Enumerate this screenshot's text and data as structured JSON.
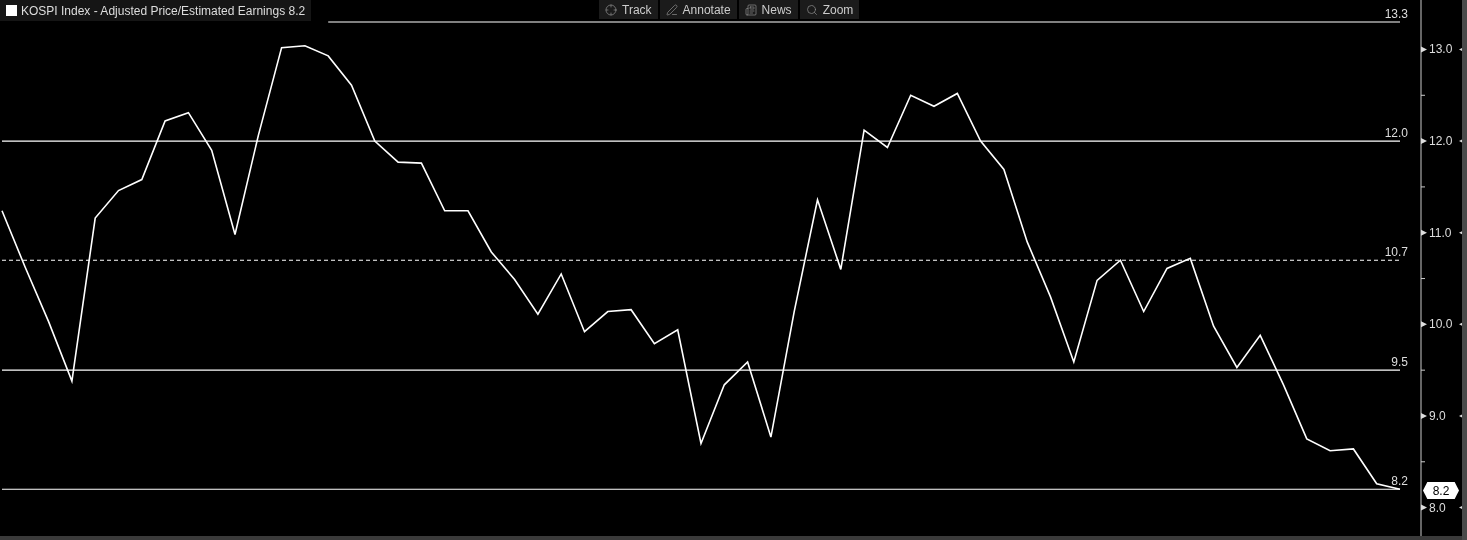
{
  "legend": {
    "label": "KOSPI Index - Adjusted Price/Estimated Earnings 8.2"
  },
  "toolbar": [
    {
      "label": "Track",
      "kind": "track"
    },
    {
      "label": "Annotate",
      "kind": "annotate"
    },
    {
      "label": "News",
      "kind": "news"
    },
    {
      "label": "Zoom",
      "kind": "zoom"
    }
  ],
  "chart": {
    "last_value": "8.2",
    "chart_data": {
      "type": "line",
      "ylim": [
        7.69,
        13.54
      ],
      "yticks": [
        {
          "value": 8,
          "label": "8.0"
        },
        {
          "value": 9,
          "label": "9.0"
        },
        {
          "value": 10,
          "label": "10.0"
        },
        {
          "value": 11,
          "label": "11.0"
        },
        {
          "value": 12,
          "label": "12.0"
        },
        {
          "value": 13,
          "label": "13.0"
        }
      ],
      "series": [
        {
          "color": "#ffffff",
          "line_style": "solid",
          "values": [
            11.24,
            10.62,
            10.03,
            9.38,
            11.16,
            11.46,
            11.58,
            12.22,
            12.31,
            11.9,
            10.98,
            12.06,
            13.02,
            13.04,
            12.93,
            12.61,
            12.0,
            11.77,
            11.76,
            11.24,
            11.24,
            10.79,
            10.49,
            10.11,
            10.55,
            9.92,
            10.14,
            10.16,
            9.79,
            9.94,
            8.7,
            9.34,
            9.59,
            8.77,
            10.14,
            11.36,
            10.6,
            12.12,
            11.93,
            12.5,
            12.38,
            12.52,
            12.0,
            11.69,
            10.9,
            10.3,
            9.59,
            10.48,
            10.7,
            10.14,
            10.61,
            10.72,
            9.98,
            9.53,
            9.88,
            9.34,
            8.75,
            8.62,
            8.64,
            8.26,
            8.2
          ]
        },
        {
          "name": "13.3",
          "color": "#ffffff",
          "line_style": "solid",
          "values": [
            null,
            null,
            null,
            null,
            null,
            null,
            null,
            null,
            null,
            null,
            null,
            null,
            null,
            null,
            13.3,
            13.3,
            13.3,
            13.3,
            13.3,
            13.3,
            13.3,
            13.3,
            13.3,
            13.3,
            13.3,
            13.3,
            13.3,
            13.3,
            13.3,
            13.3,
            13.3,
            13.3,
            13.3,
            13.3,
            13.3,
            13.3,
            13.3,
            13.3,
            13.3,
            13.3,
            13.3,
            13.3,
            13.3,
            13.3,
            13.3,
            13.3,
            13.3,
            13.3,
            13.3,
            13.3,
            13.3,
            13.3,
            13.3,
            13.3,
            13.3,
            13.3,
            13.3,
            13.3,
            13.3,
            13.3,
            13.3
          ]
        },
        {
          "name": "12.0",
          "color": "#ffffff",
          "line_style": "solid",
          "values": [
            12.0,
            12.0,
            12.0,
            12.0,
            12.0,
            12.0,
            12.0,
            12.0,
            12.0,
            12.0,
            12.0,
            12.0,
            12.0,
            12.0,
            12.0,
            12.0,
            12.0,
            12.0,
            12.0,
            12.0,
            12.0,
            12.0,
            12.0,
            12.0,
            12.0,
            12.0,
            12.0,
            12.0,
            12.0,
            12.0,
            12.0,
            12.0,
            12.0,
            12.0,
            12.0,
            12.0,
            12.0,
            12.0,
            12.0,
            12.0,
            12.0,
            12.0,
            12.0,
            12.0,
            12.0,
            12.0,
            12.0,
            12.0,
            12.0,
            12.0,
            12.0,
            12.0,
            12.0,
            12.0,
            12.0,
            12.0,
            12.0,
            12.0,
            12.0,
            12.0,
            12.0
          ]
        },
        {
          "name": "10.7",
          "color": "#ffffff",
          "line_style": "dashed",
          "values": [
            10.7,
            10.7,
            10.7,
            10.7,
            10.7,
            10.7,
            10.7,
            10.7,
            10.7,
            10.7,
            10.7,
            10.7,
            10.7,
            10.7,
            10.7,
            10.7,
            10.7,
            10.7,
            10.7,
            10.7,
            10.7,
            10.7,
            10.7,
            10.7,
            10.7,
            10.7,
            10.7,
            10.7,
            10.7,
            10.7,
            10.7,
            10.7,
            10.7,
            10.7,
            10.7,
            10.7,
            10.7,
            10.7,
            10.7,
            10.7,
            10.7,
            10.7,
            10.7,
            10.7,
            10.7,
            10.7,
            10.7,
            10.7,
            10.7,
            10.7,
            10.7,
            10.7,
            10.7,
            10.7,
            10.7,
            10.7,
            10.7,
            10.7,
            10.7,
            10.7,
            10.7
          ]
        },
        {
          "name": "9.5",
          "color": "#ffffff",
          "line_style": "solid",
          "values": [
            9.5,
            9.5,
            9.5,
            9.5,
            9.5,
            9.5,
            9.5,
            9.5,
            9.5,
            9.5,
            9.5,
            9.5,
            9.5,
            9.5,
            9.5,
            9.5,
            9.5,
            9.5,
            9.5,
            9.5,
            9.5,
            9.5,
            9.5,
            9.5,
            9.5,
            9.5,
            9.5,
            9.5,
            9.5,
            9.5,
            9.5,
            9.5,
            9.5,
            9.5,
            9.5,
            9.5,
            9.5,
            9.5,
            9.5,
            9.5,
            9.5,
            9.5,
            9.5,
            9.5,
            9.5,
            9.5,
            9.5,
            9.5,
            9.5,
            9.5,
            9.5,
            9.5,
            9.5,
            9.5,
            9.5,
            9.5,
            9.5,
            9.5,
            9.5,
            9.5,
            9.5
          ]
        },
        {
          "name": "8.2",
          "color": "#ffffff",
          "line_style": "solid",
          "values": [
            8.2,
            8.2,
            8.2,
            8.2,
            8.2,
            8.2,
            8.2,
            8.2,
            8.2,
            8.2,
            8.2,
            8.2,
            8.2,
            8.2,
            8.2,
            8.2,
            8.2,
            8.2,
            8.2,
            8.2,
            8.2,
            8.2,
            8.2,
            8.2,
            8.2,
            8.2,
            8.2,
            8.2,
            8.2,
            8.2,
            8.2,
            8.2,
            8.2,
            8.2,
            8.2,
            8.2,
            8.2,
            8.2,
            8.2,
            8.2,
            8.2,
            8.2,
            8.2,
            8.2,
            8.2,
            8.2,
            8.2,
            8.2,
            8.2,
            8.2,
            8.2,
            8.2,
            8.2,
            8.2,
            8.2,
            8.2,
            8.2,
            8.2,
            8.2,
            8.2,
            8.2
          ]
        }
      ]
    }
  }
}
